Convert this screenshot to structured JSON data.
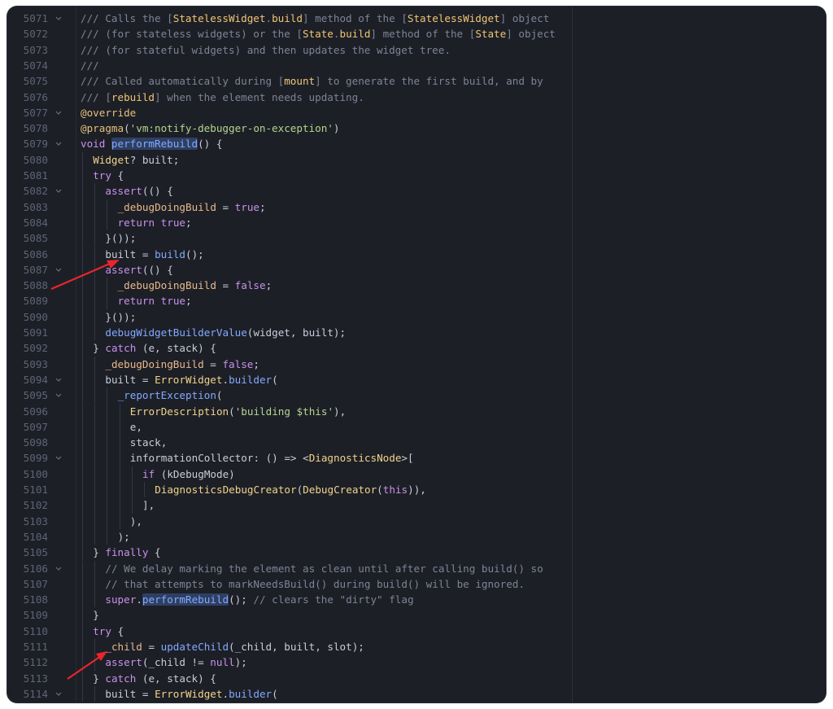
{
  "editor": {
    "colors": {
      "background": "#1d1f27",
      "comment": "#7d8495",
      "keyword": "#c792ea",
      "string": "#b5d68e",
      "function": "#82aaff",
      "type": "#f0d48a",
      "annotation_arrow": "#e8262b"
    },
    "fold_icon": "chevron-down-icon",
    "lines": [
      {
        "num": "5071",
        "fold": true,
        "indent": 0,
        "tokens": [
          [
            "cmt",
            "/// Calls the ["
          ],
          [
            "ref",
            "StatelessWidget"
          ],
          [
            "cmt",
            "."
          ],
          [
            "ref",
            "build"
          ],
          [
            "cmt",
            "] method of the ["
          ],
          [
            "ref",
            "StatelessWidget"
          ],
          [
            "cmt",
            "] object"
          ]
        ]
      },
      {
        "num": "5072",
        "fold": false,
        "indent": 0,
        "tokens": [
          [
            "cmt",
            "/// (for stateless widgets) or the ["
          ],
          [
            "ref",
            "State"
          ],
          [
            "cmt",
            "."
          ],
          [
            "ref",
            "build"
          ],
          [
            "cmt",
            "] method of the ["
          ],
          [
            "ref",
            "State"
          ],
          [
            "cmt",
            "] object"
          ]
        ]
      },
      {
        "num": "5073",
        "fold": false,
        "indent": 0,
        "tokens": [
          [
            "cmt",
            "/// (for stateful widgets) and then updates the widget tree."
          ]
        ]
      },
      {
        "num": "5074",
        "fold": false,
        "indent": 0,
        "tokens": [
          [
            "cmt",
            "///"
          ]
        ]
      },
      {
        "num": "5075",
        "fold": false,
        "indent": 0,
        "tokens": [
          [
            "cmt",
            "/// Called automatically during ["
          ],
          [
            "ref",
            "mount"
          ],
          [
            "cmt",
            "] to generate the first build, and by"
          ]
        ]
      },
      {
        "num": "5076",
        "fold": false,
        "indent": 0,
        "tokens": [
          [
            "cmt",
            "/// ["
          ],
          [
            "ref",
            "rebuild"
          ],
          [
            "cmt",
            "] when the element needs updating."
          ]
        ]
      },
      {
        "num": "5077",
        "fold": true,
        "indent": 0,
        "tokens": [
          [
            "deco",
            "@override"
          ]
        ]
      },
      {
        "num": "5078",
        "fold": false,
        "indent": 0,
        "tokens": [
          [
            "deco",
            "@pragma"
          ],
          [
            "plain",
            "("
          ],
          [
            "str",
            "'vm:notify-debugger-on-exception'"
          ],
          [
            "plain",
            ")"
          ]
        ]
      },
      {
        "num": "5079",
        "fold": true,
        "indent": 0,
        "tokens": [
          [
            "kw",
            "void "
          ],
          [
            "hlfn",
            "performRebuild"
          ],
          [
            "plain",
            "() {"
          ]
        ]
      },
      {
        "num": "5080",
        "fold": false,
        "indent": 1,
        "tokens": [
          [
            "type",
            "Widget"
          ],
          [
            "plain",
            "? built;"
          ]
        ]
      },
      {
        "num": "5081",
        "fold": false,
        "indent": 1,
        "tokens": [
          [
            "kw",
            "try"
          ],
          [
            "plain",
            " {"
          ]
        ]
      },
      {
        "num": "5082",
        "fold": true,
        "indent": 2,
        "tokens": [
          [
            "kw",
            "assert"
          ],
          [
            "plain",
            "(() {"
          ]
        ]
      },
      {
        "num": "5083",
        "fold": false,
        "indent": 3,
        "tokens": [
          [
            "var",
            "_debugDoingBuild"
          ],
          [
            "plain",
            " = "
          ],
          [
            "kw",
            "true"
          ],
          [
            "plain",
            ";"
          ]
        ]
      },
      {
        "num": "5084",
        "fold": false,
        "indent": 3,
        "tokens": [
          [
            "kw",
            "return true"
          ],
          [
            "plain",
            ";"
          ]
        ]
      },
      {
        "num": "5085",
        "fold": false,
        "indent": 2,
        "tokens": [
          [
            "plain",
            "}());"
          ]
        ]
      },
      {
        "num": "5086",
        "fold": false,
        "indent": 2,
        "tokens": [
          [
            "plain",
            "built = "
          ],
          [
            "fn",
            "build"
          ],
          [
            "plain",
            "();"
          ]
        ]
      },
      {
        "num": "5087",
        "fold": true,
        "indent": 2,
        "tokens": [
          [
            "kw",
            "assert"
          ],
          [
            "plain",
            "(() {"
          ]
        ]
      },
      {
        "num": "5088",
        "fold": false,
        "indent": 3,
        "tokens": [
          [
            "var",
            "_debugDoingBuild"
          ],
          [
            "plain",
            " = "
          ],
          [
            "kw",
            "false"
          ],
          [
            "plain",
            ";"
          ]
        ]
      },
      {
        "num": "5089",
        "fold": false,
        "indent": 3,
        "tokens": [
          [
            "kw",
            "return true"
          ],
          [
            "plain",
            ";"
          ]
        ]
      },
      {
        "num": "5090",
        "fold": false,
        "indent": 2,
        "tokens": [
          [
            "plain",
            "}());"
          ]
        ]
      },
      {
        "num": "5091",
        "fold": false,
        "indent": 2,
        "tokens": [
          [
            "fn",
            "debugWidgetBuilderValue"
          ],
          [
            "plain",
            "(widget, built);"
          ]
        ]
      },
      {
        "num": "5092",
        "fold": false,
        "indent": 1,
        "tokens": [
          [
            "plain",
            "} "
          ],
          [
            "kw",
            "catch"
          ],
          [
            "plain",
            " (e, stack) {"
          ]
        ]
      },
      {
        "num": "5093",
        "fold": false,
        "indent": 2,
        "tokens": [
          [
            "var",
            "_debugDoingBuild"
          ],
          [
            "plain",
            " = "
          ],
          [
            "kw",
            "false"
          ],
          [
            "plain",
            ";"
          ]
        ]
      },
      {
        "num": "5094",
        "fold": true,
        "indent": 2,
        "tokens": [
          [
            "plain",
            "built = "
          ],
          [
            "type",
            "ErrorWidget"
          ],
          [
            "plain",
            "."
          ],
          [
            "fn",
            "builder"
          ],
          [
            "plain",
            "("
          ]
        ]
      },
      {
        "num": "5095",
        "fold": true,
        "indent": 3,
        "tokens": [
          [
            "fn",
            "_reportException"
          ],
          [
            "plain",
            "("
          ]
        ]
      },
      {
        "num": "5096",
        "fold": false,
        "indent": 4,
        "tokens": [
          [
            "type",
            "ErrorDescription"
          ],
          [
            "plain",
            "("
          ],
          [
            "str",
            "'building $this'"
          ],
          [
            "plain",
            "),"
          ]
        ]
      },
      {
        "num": "5097",
        "fold": false,
        "indent": 4,
        "tokens": [
          [
            "plain",
            "e,"
          ]
        ]
      },
      {
        "num": "5098",
        "fold": false,
        "indent": 4,
        "tokens": [
          [
            "plain",
            "stack,"
          ]
        ]
      },
      {
        "num": "5099",
        "fold": true,
        "indent": 4,
        "tokens": [
          [
            "plain",
            "informationCollector: () => <"
          ],
          [
            "type",
            "DiagnosticsNode"
          ],
          [
            "plain",
            ">["
          ]
        ]
      },
      {
        "num": "5100",
        "fold": false,
        "indent": 5,
        "tokens": [
          [
            "kw",
            "if"
          ],
          [
            "plain",
            " (kDebugMode)"
          ]
        ]
      },
      {
        "num": "5101",
        "fold": false,
        "indent": 6,
        "tokens": [
          [
            "type",
            "DiagnosticsDebugCreator"
          ],
          [
            "plain",
            "("
          ],
          [
            "type",
            "DebugCreator"
          ],
          [
            "plain",
            "("
          ],
          [
            "kw",
            "this"
          ],
          [
            "plain",
            ")),"
          ]
        ]
      },
      {
        "num": "5102",
        "fold": false,
        "indent": 5,
        "tokens": [
          [
            "plain",
            "],"
          ]
        ]
      },
      {
        "num": "5103",
        "fold": false,
        "indent": 4,
        "tokens": [
          [
            "plain",
            "),"
          ]
        ]
      },
      {
        "num": "5104",
        "fold": false,
        "indent": 3,
        "tokens": [
          [
            "plain",
            ");"
          ]
        ]
      },
      {
        "num": "5105",
        "fold": false,
        "indent": 1,
        "tokens": [
          [
            "plain",
            "} "
          ],
          [
            "kw",
            "finally"
          ],
          [
            "plain",
            " {"
          ]
        ]
      },
      {
        "num": "5106",
        "fold": true,
        "indent": 2,
        "tokens": [
          [
            "cmt",
            "// We delay marking the element as clean until after calling build() so"
          ]
        ]
      },
      {
        "num": "5107",
        "fold": false,
        "indent": 2,
        "tokens": [
          [
            "cmt",
            "// that attempts to markNeedsBuild() during build() will be ignored."
          ]
        ]
      },
      {
        "num": "5108",
        "fold": false,
        "indent": 2,
        "tokens": [
          [
            "kw",
            "super"
          ],
          [
            "plain",
            "."
          ],
          [
            "hlfn",
            "performRebuild"
          ],
          [
            "plain",
            "(); "
          ],
          [
            "cmt",
            "// clears the \"dirty\" flag"
          ]
        ]
      },
      {
        "num": "5109",
        "fold": false,
        "indent": 1,
        "tokens": [
          [
            "plain",
            "}"
          ]
        ]
      },
      {
        "num": "5110",
        "fold": false,
        "indent": 1,
        "tokens": [
          [
            "kw",
            "try"
          ],
          [
            "plain",
            " {"
          ]
        ]
      },
      {
        "num": "5111",
        "fold": false,
        "indent": 2,
        "tokens": [
          [
            "var",
            "_child"
          ],
          [
            "plain",
            " = "
          ],
          [
            "fn",
            "updateChild"
          ],
          [
            "plain",
            "(_child, built, slot);"
          ]
        ]
      },
      {
        "num": "5112",
        "fold": false,
        "indent": 2,
        "tokens": [
          [
            "kw",
            "assert"
          ],
          [
            "plain",
            "(_child != "
          ],
          [
            "kw",
            "null"
          ],
          [
            "plain",
            ");"
          ]
        ]
      },
      {
        "num": "5113",
        "fold": false,
        "indent": 1,
        "tokens": [
          [
            "plain",
            "} "
          ],
          [
            "kw",
            "catch"
          ],
          [
            "plain",
            " (e, stack) {"
          ]
        ]
      },
      {
        "num": "5114",
        "fold": true,
        "indent": 2,
        "tokens": [
          [
            "plain",
            "built = "
          ],
          [
            "type",
            "ErrorWidget"
          ],
          [
            "plain",
            "."
          ],
          [
            "fn",
            "builder"
          ],
          [
            "plain",
            "("
          ]
        ]
      }
    ]
  }
}
